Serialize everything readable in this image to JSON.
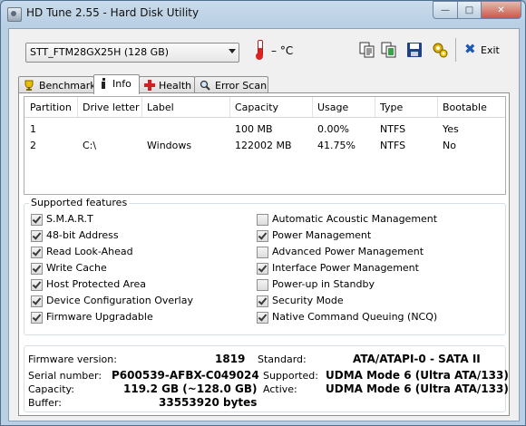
{
  "window": {
    "title": "HD Tune 2.55 - Hard Disk Utility"
  },
  "toolbar": {
    "drive": "STT_FTM28GX25H (128 GB)",
    "temperature": "– °C",
    "exit_label": "Exit",
    "icons": [
      "copy-text-icon",
      "copy-screenshot-icon",
      "save-icon",
      "options-icon"
    ]
  },
  "tabs": [
    "Benchmark",
    "Info",
    "Health",
    "Error Scan"
  ],
  "active_tab": "Info",
  "partitions": {
    "columns": [
      "Partition",
      "Drive letter",
      "Label",
      "Capacity",
      "Usage",
      "Type",
      "Bootable"
    ],
    "rows": [
      [
        "1",
        "",
        "",
        "100 MB",
        "0.00%",
        "NTFS",
        "Yes"
      ],
      [
        "2",
        "C:\\",
        "Windows",
        "122002 MB",
        "41.75%",
        "NTFS",
        "No"
      ]
    ]
  },
  "features": {
    "legend": "Supported features",
    "left": [
      {
        "label": "S.M.A.R.T",
        "checked": true
      },
      {
        "label": "48-bit Address",
        "checked": true
      },
      {
        "label": "Read Look-Ahead",
        "checked": true
      },
      {
        "label": "Write Cache",
        "checked": true
      },
      {
        "label": "Host Protected Area",
        "checked": true
      },
      {
        "label": "Device Configuration Overlay",
        "checked": true
      },
      {
        "label": "Firmware Upgradable",
        "checked": true
      }
    ],
    "right": [
      {
        "label": "Automatic Acoustic Management",
        "checked": false
      },
      {
        "label": "Power Management",
        "checked": true
      },
      {
        "label": "Advanced Power Management",
        "checked": false
      },
      {
        "label": "Interface Power Management",
        "checked": true
      },
      {
        "label": "Power-up in Standby",
        "checked": false
      },
      {
        "label": "Security Mode",
        "checked": true
      },
      {
        "label": "Native Command Queuing (NCQ)",
        "checked": true
      }
    ]
  },
  "drive_info": {
    "firmware_label": "Firmware version:",
    "firmware": "1819",
    "serial_label": "Serial number:",
    "serial": "P600539-AFBX-C049024",
    "capacity_label": "Capacity:",
    "capacity": "119.2 GB (~128.0 GB)",
    "buffer_label": "Buffer:",
    "buffer": "33553920 bytes",
    "standard_label": "Standard:",
    "standard": "ATA/ATAPI-0 - SATA II",
    "supported_label": "Supported:",
    "supported": "UDMA Mode 6 (Ultra ATA/133)",
    "active_label": "Active:",
    "active": "UDMA Mode 6 (Ultra ATA/133)"
  }
}
